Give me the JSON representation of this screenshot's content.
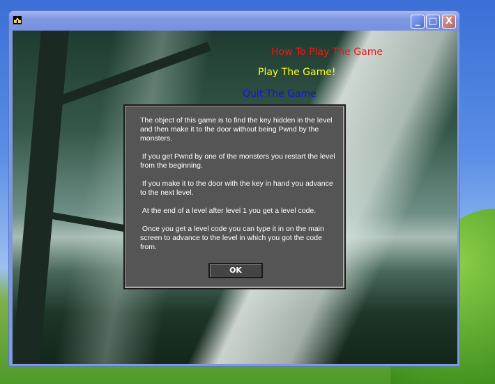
{
  "window": {
    "title": "",
    "buttons": {
      "minimize": "_",
      "maximize": "□",
      "close": "X"
    }
  },
  "menu": {
    "how_to_play": "How To Play The Game",
    "play": "Play The Game!",
    "quit": "Quit The Game"
  },
  "dialog": {
    "text": "The object of this game is to find the key hidden in the level and then make it to the door without being Pwnd by the monsters.\n\n If you get Pwnd by one of the monsters you restart the level from the beginning.\n\n If you make it to the door with the key in hand you advance to the next level.\n\n At the end of a level after level 1 you get a level code.\n\n Once you get a level code you can type it in on the main screen to advance to the level in which you got the code from.",
    "ok_label": "OK"
  }
}
